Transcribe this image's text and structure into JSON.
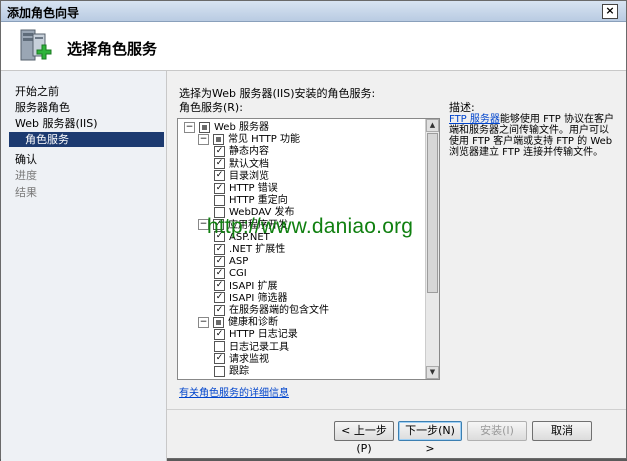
{
  "window": {
    "title": "添加角色向导",
    "close_glyph": "×"
  },
  "header": {
    "title": "选择角色服务",
    "icon": "server-roles-add-icon"
  },
  "nav": {
    "items": [
      {
        "label": "开始之前",
        "state": "normal"
      },
      {
        "label": "服务器角色",
        "state": "normal"
      },
      {
        "label": "Web 服务器(IIS)",
        "state": "normal"
      },
      {
        "label": "角色服务",
        "state": "selected"
      },
      {
        "label": "确认",
        "state": "normal"
      },
      {
        "label": "进度",
        "state": "dim"
      },
      {
        "label": "结果",
        "state": "dim"
      }
    ]
  },
  "main": {
    "instruction": "选择为Web 服务器(IIS)安装的角色服务:",
    "tree_label": "角色服务(R):",
    "tree": [
      {
        "label": "Web 服务器",
        "level": 0,
        "expander": "−",
        "check": "partial"
      },
      {
        "label": "常见 HTTP 功能",
        "level": 1,
        "expander": "−",
        "check": "partial"
      },
      {
        "label": "静态内容",
        "level": 2,
        "check": "checked"
      },
      {
        "label": "默认文档",
        "level": 2,
        "check": "checked"
      },
      {
        "label": "目录浏览",
        "level": 2,
        "check": "checked"
      },
      {
        "label": "HTTP 错误",
        "level": 2,
        "check": "checked"
      },
      {
        "label": "HTTP 重定向",
        "level": 2,
        "check": "unchecked"
      },
      {
        "label": "WebDAV 发布",
        "level": 2,
        "check": "unchecked"
      },
      {
        "label": "应用程序开发",
        "level": 1,
        "expander": "−",
        "check": "checked"
      },
      {
        "label": "ASP.NET",
        "level": 2,
        "check": "checked"
      },
      {
        "label": ".NET 扩展性",
        "level": 2,
        "check": "checked"
      },
      {
        "label": "ASP",
        "level": 2,
        "check": "checked"
      },
      {
        "label": "CGI",
        "level": 2,
        "check": "checked"
      },
      {
        "label": "ISAPI 扩展",
        "level": 2,
        "check": "checked"
      },
      {
        "label": "ISAPI 筛选器",
        "level": 2,
        "check": "checked"
      },
      {
        "label": "在服务器端的包含文件",
        "level": 2,
        "check": "checked"
      },
      {
        "label": "健康和诊断",
        "level": 1,
        "expander": "−",
        "check": "partial"
      },
      {
        "label": "HTTP 日志记录",
        "level": 2,
        "check": "checked"
      },
      {
        "label": "日志记录工具",
        "level": 2,
        "check": "unchecked"
      },
      {
        "label": "请求监视",
        "level": 2,
        "check": "checked"
      },
      {
        "label": "跟踪",
        "level": 2,
        "check": "unchecked"
      }
    ],
    "description_title": "描述:",
    "description_link": "FTP 服务器",
    "description_text": "能够使用 FTP 协议在客户端和服务器之间传输文件。用户可以使用 FTP 客户端或支持 FTP 的 Web 浏览器建立 FTP 连接并传输文件。",
    "more_info_link": "有关角色服务的详细信息"
  },
  "watermark": "http://www.daniao.org",
  "buttons": {
    "back": "< 上一步(P)",
    "next": "下一步(N) >",
    "install": "安装(I)",
    "cancel": "取消"
  },
  "scrollbar": {
    "up_glyph": "▲",
    "down_glyph": "▼"
  }
}
